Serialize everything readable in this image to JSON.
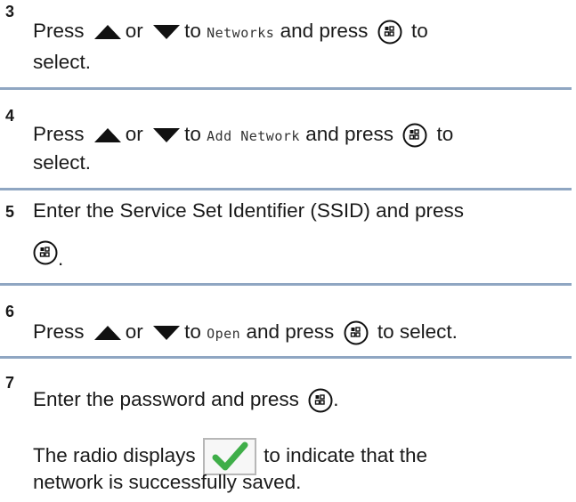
{
  "steps": [
    {
      "number": "3",
      "parts": {
        "press": "Press",
        "or": "or",
        "to": "to",
        "menu": "Networks",
        "and_press": "and press",
        "to2": "to",
        "line2": "select."
      }
    },
    {
      "number": "4",
      "parts": {
        "press": "Press",
        "or": "or",
        "to": "to",
        "menu": "Add Network",
        "and_press": "and press",
        "to2": "to",
        "line2": "select."
      }
    },
    {
      "number": "5",
      "parts": {
        "line1": "Enter the Service Set Identifier (SSID) and press",
        "period": "."
      }
    },
    {
      "number": "6",
      "parts": {
        "press": "Press",
        "or": "or",
        "to": "to",
        "menu": "Open",
        "and_press": "and press",
        "to_select": "to select."
      }
    },
    {
      "number": "7",
      "parts": {
        "line1": "Enter the password and press",
        "period": ".",
        "result_a": "The radio displays",
        "result_b": "to indicate that the",
        "result_c": "network is successfully saved."
      }
    }
  ],
  "icons": {
    "up": "up-arrow-icon",
    "down": "down-arrow-icon",
    "ok": "menu-ok-button-icon",
    "check": "checkmark-icon"
  },
  "colors": {
    "divider": "#8fa6c2",
    "check": "#3fae49"
  }
}
